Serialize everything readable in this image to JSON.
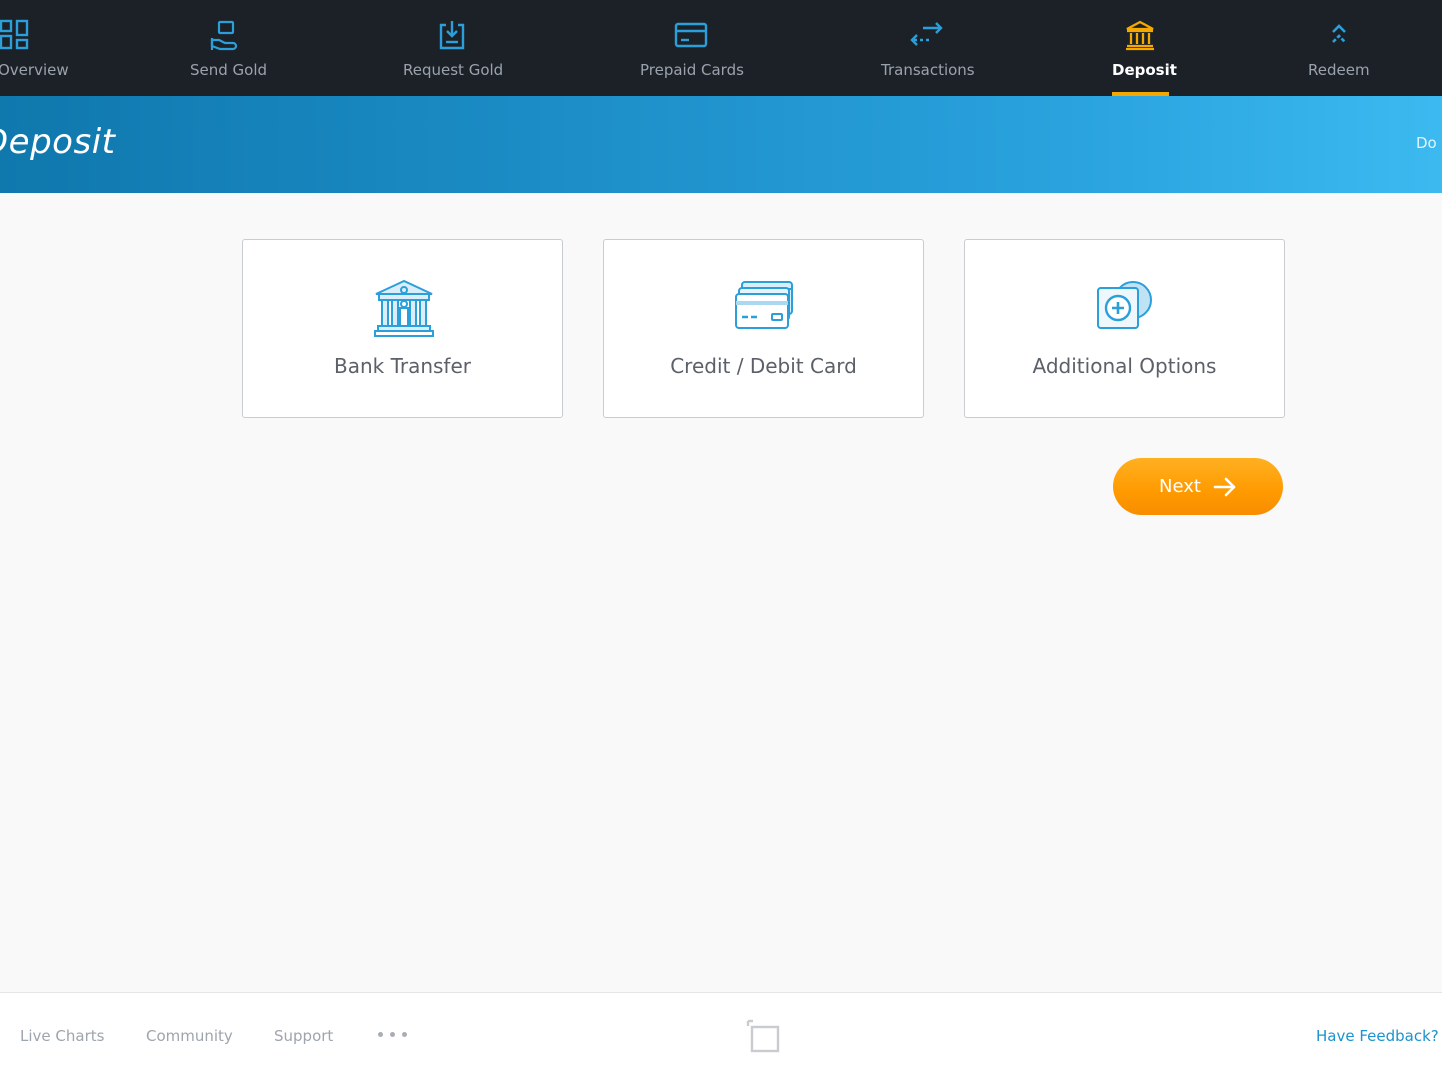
{
  "nav": {
    "items": [
      {
        "label": "Overview",
        "icon": "grid-icon"
      },
      {
        "label": "Send Gold",
        "icon": "hand-send-icon"
      },
      {
        "label": "Request Gold",
        "icon": "download-request-icon"
      },
      {
        "label": "Prepaid Cards",
        "icon": "card-icon"
      },
      {
        "label": "Transactions",
        "icon": "arrows-swap-icon"
      },
      {
        "label": "Deposit",
        "icon": "bank-icon",
        "active": true
      },
      {
        "label": "Redeem",
        "icon": "chevrons-up-icon"
      }
    ],
    "active_color": "#f5a800"
  },
  "banner": {
    "title": "Deposit",
    "right_text": "Do y"
  },
  "options": [
    {
      "label": "Bank Transfer",
      "icon": "bank-building-icon"
    },
    {
      "label": "Credit / Debit Card",
      "icon": "credit-cards-icon"
    },
    {
      "label": "Additional Options",
      "icon": "add-circle-icon"
    }
  ],
  "actions": {
    "next_label": "Next",
    "next_icon": "arrow-right-icon",
    "next_color": "#ff9a00"
  },
  "footer": {
    "links": [
      "Live Charts",
      "Community",
      "Support"
    ],
    "more_icon": "more-dots-icon",
    "logo_icon": "brand-logo-icon",
    "feedback_label": "Have Feedback?",
    "feedback_color": "#1a93cf"
  },
  "colors": {
    "nav_background": "#1c2127",
    "icon_blue": "#2b9fd9",
    "banner_start": "#0f78ad",
    "banner_end": "#3cbaf0"
  }
}
